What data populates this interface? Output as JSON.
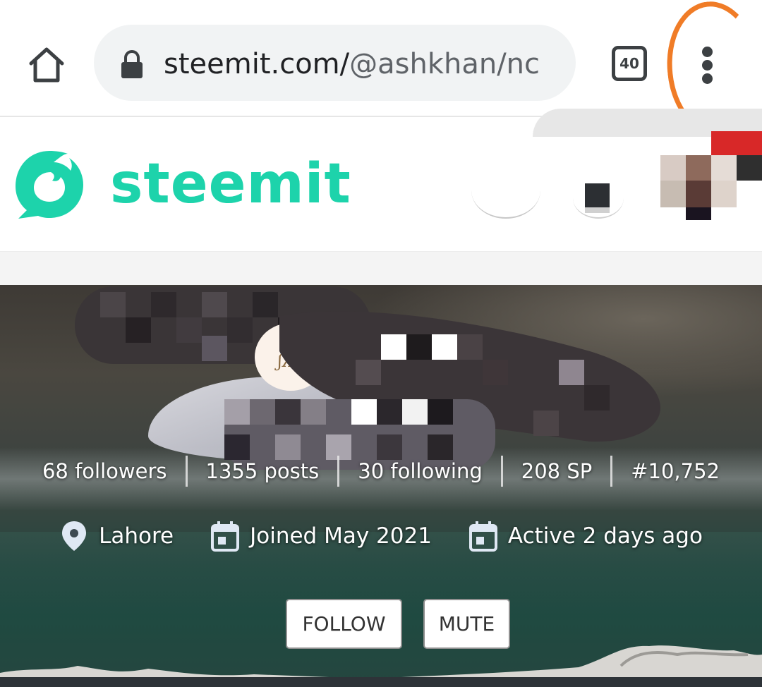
{
  "browser": {
    "url_host": "steemit.com/",
    "url_path": "@ashkhan/nc",
    "tab_count": "40",
    "icons": {
      "home": "home-icon",
      "lock": "lock-icon",
      "menu": "more-vert-icon"
    }
  },
  "site": {
    "brand": "steemit",
    "brand_color": "#1dd3ab"
  },
  "profile": {
    "stats": {
      "followers": "68 followers",
      "posts": "1355 posts",
      "following": "30 following",
      "sp": "208 SP",
      "rank": "#10,752"
    },
    "meta": {
      "location": "Lahore",
      "joined": "Joined May 2021",
      "active": "Active 2 days ago"
    },
    "actions": {
      "follow_label": "FOLLOW",
      "mute_label": "MUTE"
    }
  },
  "annotation_color": "#f07c27"
}
